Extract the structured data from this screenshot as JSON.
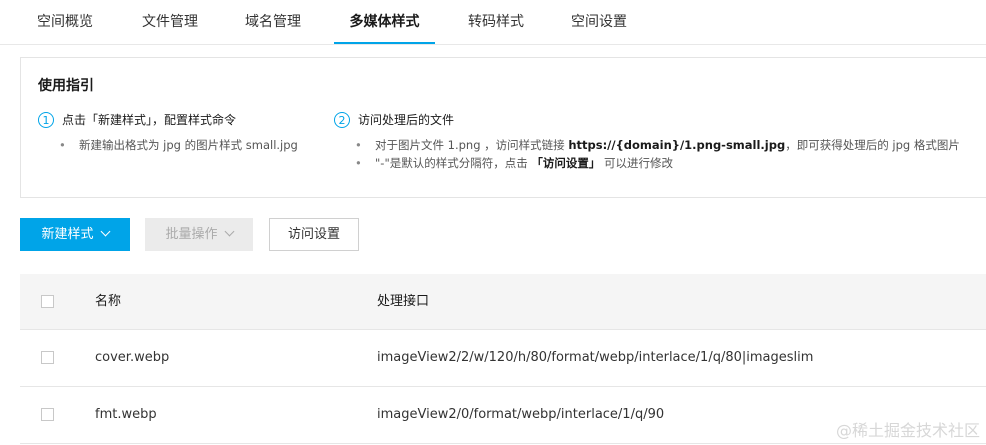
{
  "tabs": [
    {
      "label": "空间概览"
    },
    {
      "label": "文件管理"
    },
    {
      "label": "域名管理"
    },
    {
      "label": "多媒体样式",
      "active": true
    },
    {
      "label": "转码样式"
    },
    {
      "label": "空间设置"
    }
  ],
  "guide": {
    "title": "使用指引",
    "step1": {
      "num": "1",
      "title": "点击「新建样式」，配置样式命令",
      "bullets": [
        "新建输出格式为 jpg 的图片样式 small.jpg"
      ]
    },
    "step2": {
      "num": "2",
      "title": "访问处理后的文件",
      "bullet1_pre": "对于图片文件 1.png ，访问样式链接 ",
      "bullet1_link": "https://{domain}/1.png-small.jpg",
      "bullet1_post": "，即可获得处理后的 jpg 格式图片",
      "bullet2_pre": "\"-\"是默认的样式分隔符，点击 ",
      "bullet2_link": "「访问设置」",
      "bullet2_post": " 可以进行修改"
    }
  },
  "toolbar": {
    "new_label": "新建样式",
    "batch_label": "批量操作",
    "visit_label": "访问设置"
  },
  "table": {
    "headers": {
      "name": "名称",
      "api": "处理接口"
    },
    "rows": [
      {
        "name": "cover.webp",
        "api": "imageView2/2/w/120/h/80/format/webp/interlace/1/q/80|imageslim"
      },
      {
        "name": "fmt.webp",
        "api": "imageView2/0/format/webp/interlace/1/q/90"
      }
    ]
  },
  "watermark": "@稀土掘金技术社区",
  "colors": {
    "accent": "#00a4e8",
    "disabled_bg": "#ebebeb",
    "header_bg": "#f5f5f5"
  }
}
